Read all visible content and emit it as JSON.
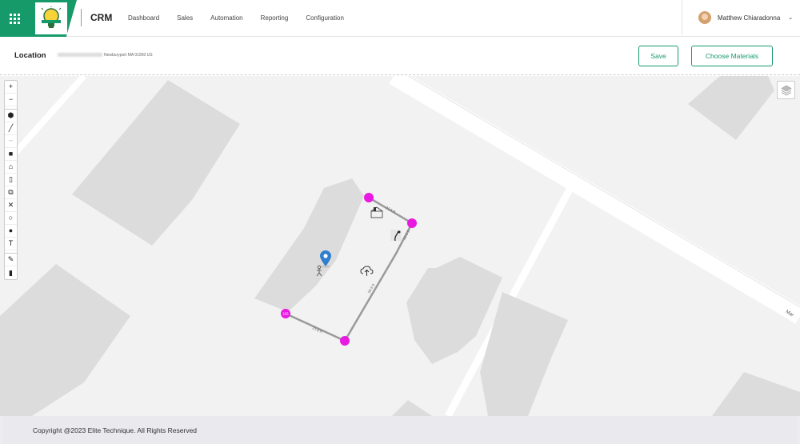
{
  "header": {
    "brand": "CRM",
    "nav": [
      "Dashboard",
      "Sales",
      "Automation",
      "Reporting",
      "Configuration"
    ],
    "user_name": "Matthew Chiaradonna",
    "accent_color": "#179a6a"
  },
  "location": {
    "label": "Location",
    "address": "Newburyport MA 01950 US",
    "save_label": "Save",
    "materials_label": "Choose Materials"
  },
  "map": {
    "street_label": "Mar",
    "polygon_color": "#e819e0",
    "edge_labels": [
      "21.5 ft",
      "21.6 ft",
      "58.9 ft",
      "23.8 ft"
    ],
    "vertex_tag": "105"
  },
  "footer": {
    "copyright": "Copyright @2023 Elite Technique. All Rights Reserved"
  }
}
